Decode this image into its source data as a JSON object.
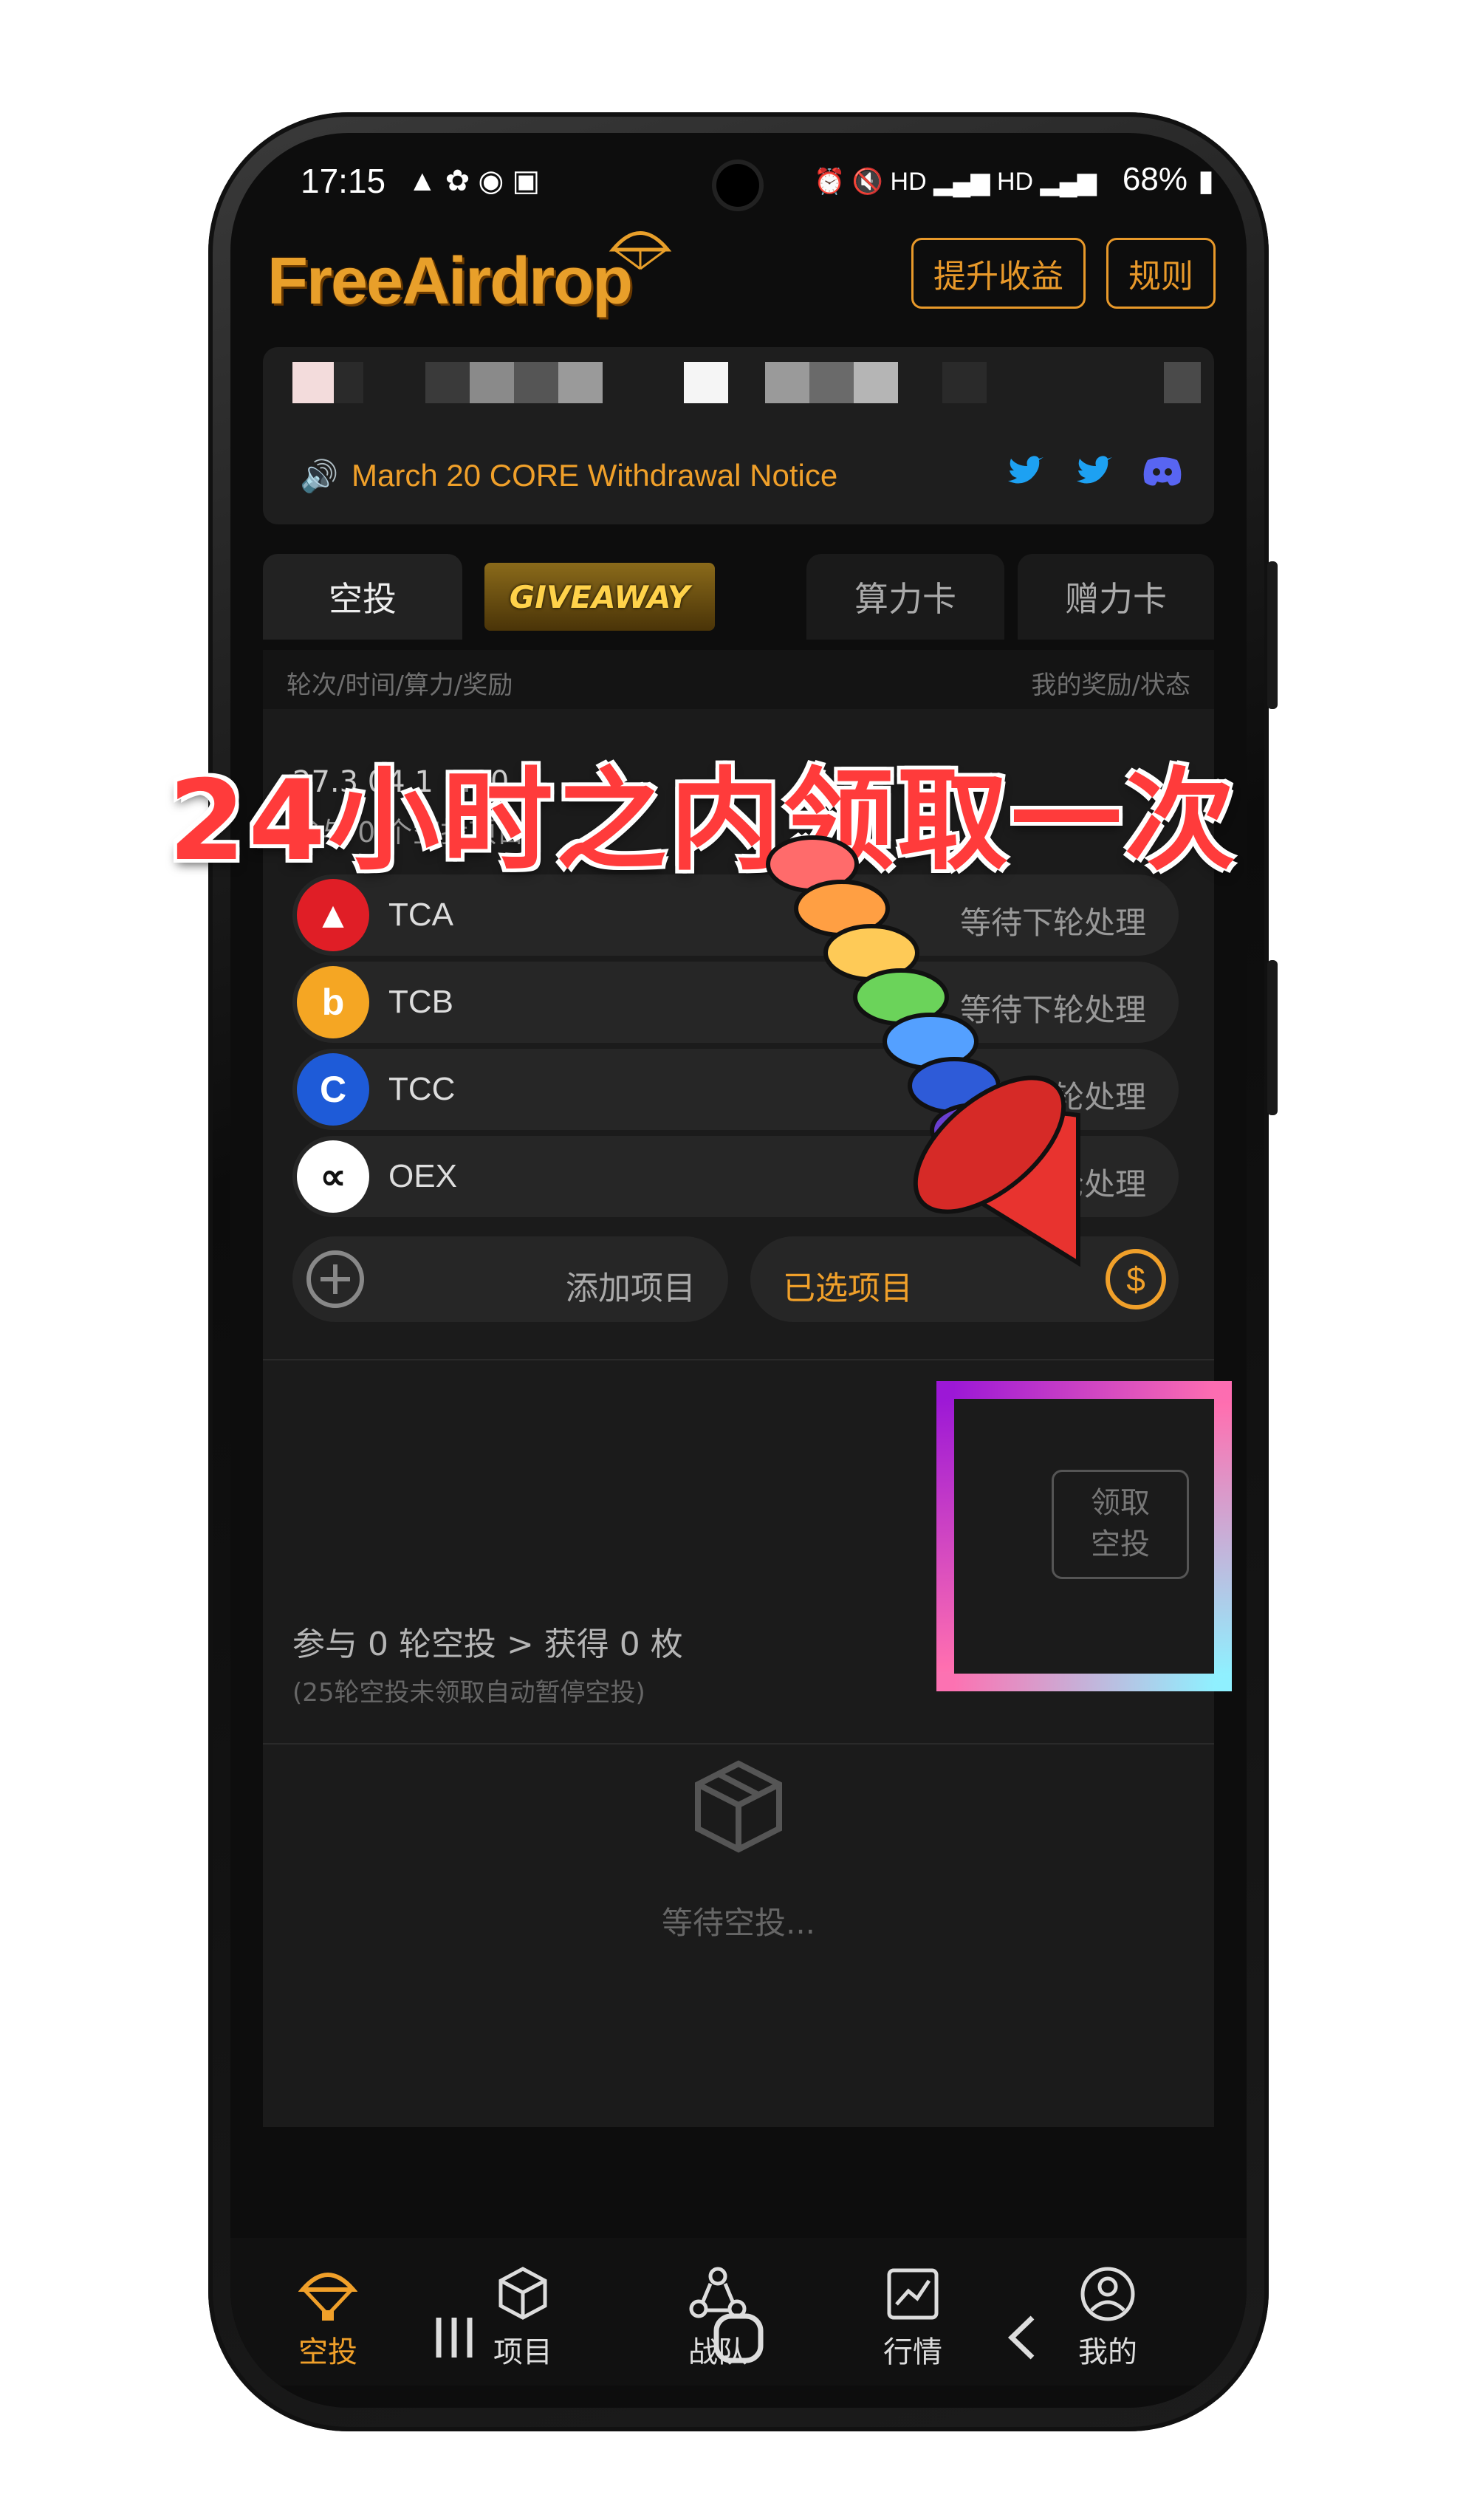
{
  "status_bar": {
    "time": "17:15",
    "battery": "68%"
  },
  "header": {
    "logo": "FreeAirdrop",
    "upgrade_btn": "提升收益",
    "rules_btn": "规则"
  },
  "banner": {
    "notice": "March 20 CORE Withdrawal Notice"
  },
  "tabs": {
    "airdrop": "空投",
    "giveaway": "GIVEAWAY",
    "power_card": "算力卡",
    "gift_card": "赠力卡"
  },
  "subheader": {
    "left": "轮次/时间/算力/奖励",
    "right": "我的奖励/状态"
  },
  "round": {
    "time_label": "27.3 04 1 1:00",
    "participation_label": "参与 0 个空投项目"
  },
  "overlay": {
    "headline": "24小时之内领取一次"
  },
  "projects": [
    {
      "name": "TCA",
      "status": "等待下轮处理",
      "color": "#e01e26"
    },
    {
      "name": "TCB",
      "status": "等待下轮处理",
      "color": "#f5a623"
    },
    {
      "name": "TCC",
      "status": "等待下轮处理",
      "color": "#1e5bd8"
    },
    {
      "name": "OEX",
      "status": "等待下轮处理",
      "color": "#ffffff"
    }
  ],
  "actions": {
    "add_project": "添加项目",
    "selected_projects": "已选项目"
  },
  "claim": {
    "summary": "参与 0 轮空投 > 获得 0 枚",
    "note": "(25轮空投未领取自动暂停空投)",
    "button_line1": "领取",
    "button_line2": "空投"
  },
  "empty_state": {
    "text": "等待空投..."
  },
  "bottom_nav": {
    "airdrop": "空投",
    "projects": "项目",
    "team": "战队",
    "market": "行情",
    "mine": "我的"
  }
}
